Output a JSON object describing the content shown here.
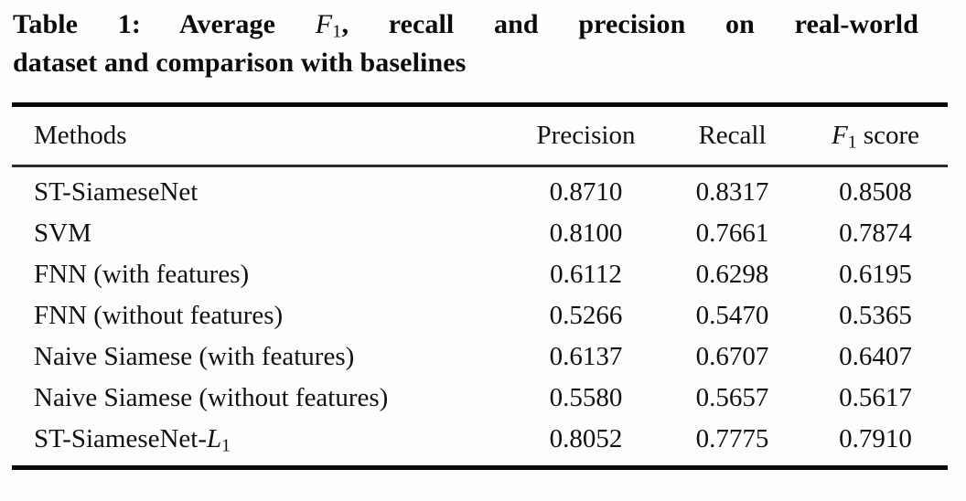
{
  "caption": {
    "line1_before": "Table 1: Average ",
    "line1_math_base": "F",
    "line1_math_sub": "1",
    "line1_after": ", recall and precision on real-world",
    "line2": "dataset and comparison with baselines"
  },
  "table": {
    "headers": {
      "methods": "Methods",
      "precision": "Precision",
      "recall": "Recall",
      "f1_base": "F",
      "f1_sub": "1",
      "f1_suffix": " score"
    },
    "rows": [
      {
        "method": "ST-SiameseNet",
        "precision": "0.8710",
        "recall": "0.8317",
        "f1": "0.8508",
        "bold": true
      },
      {
        "method": "SVM",
        "precision": "0.8100",
        "recall": "0.7661",
        "f1": "0.7874",
        "bold": false
      },
      {
        "method": "FNN (with features)",
        "precision": "0.6112",
        "recall": "0.6298",
        "f1": "0.6195",
        "bold": false
      },
      {
        "method": "FNN (without features)",
        "precision": "0.5266",
        "recall": "0.5470",
        "f1": "0.5365",
        "bold": false
      },
      {
        "method": "Naive Siamese (with features)",
        "precision": "0.6137",
        "recall": "0.6707",
        "f1": "0.6407",
        "bold": false
      },
      {
        "method": "Naive Siamese (without features)",
        "precision": "0.5580",
        "recall": "0.5657",
        "f1": "0.5617",
        "bold": false
      },
      {
        "method_prefix": "ST-SiameseNet-",
        "method_math_base": "L",
        "method_math_sub": "1",
        "method": "ST-SiameseNet-L1",
        "precision": "0.8052",
        "recall": "0.7775",
        "f1": "0.7910",
        "bold": false
      }
    ]
  },
  "colors": {
    "rule": "#0a0a0a",
    "rule_mid": "#2b2b2b",
    "text": "#111111",
    "background": "#fdfdfd"
  }
}
